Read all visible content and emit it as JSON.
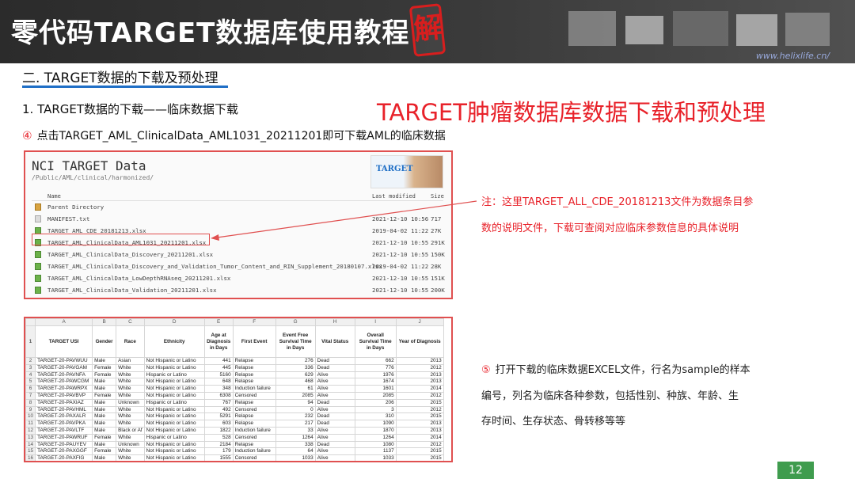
{
  "banner": {
    "title": "零代码TARGET数据库使用教程",
    "seal_char": "解",
    "site_url": "www.helixlife.cn/"
  },
  "section_title": "二. TARGET数据的下载及预处理",
  "sub_title": "1. TARGET数据的下载——临床数据下载",
  "big_title": "TARGET肿瘤数据库数据下载和预处理",
  "step4": {
    "circle": "④",
    "text": "点击TARGET_AML_ClinicalData_AML1031_20211201即可下载AML的临床数据"
  },
  "nci": {
    "title": "NCI TARGET Data",
    "path": "/Public/AML/clinical/harmonized/",
    "logo_text": "TARGET",
    "col_name": "Name",
    "col_modified": "Last modified",
    "col_size": "Size",
    "rows": [
      {
        "icon": "folder",
        "name": "Parent Directory",
        "modified": "",
        "size": ""
      },
      {
        "icon": "txt",
        "name": "MANIFEST.txt",
        "modified": "2021-12-10 10:56",
        "size": "717"
      },
      {
        "icon": "xlsx",
        "name": "TARGET_AML_CDE_20181213.xlsx",
        "modified": "2019-04-02 11:22",
        "size": "27K"
      },
      {
        "icon": "xlsx",
        "name": "TARGET_AML_ClinicalData_AML1031_20211201.xlsx",
        "modified": "2021-12-10 10:55",
        "size": "291K"
      },
      {
        "icon": "xlsx",
        "name": "TARGET_AML_ClinicalData_Discovery_20211201.xlsx",
        "modified": "2021-12-10 10:55",
        "size": "150K"
      },
      {
        "icon": "xlsx",
        "name": "TARGET_AML_ClinicalData_Discovery_and_Validation_Tumor_Content_and_RIN_Supplement_20180107.xlsx",
        "modified": "2019-04-02 11:22",
        "size": "28K"
      },
      {
        "icon": "xlsx",
        "name": "TARGET_AML_ClinicalData_LowDepthRNAseq_20211201.xlsx",
        "modified": "2021-12-10 10:55",
        "size": "151K"
      },
      {
        "icon": "xlsx",
        "name": "TARGET_AML_ClinicalData_Validation_20211201.xlsx",
        "modified": "2021-12-10 10:55",
        "size": "200K"
      }
    ]
  },
  "note_cde": {
    "line1": "注：这里TARGET_ALL_CDE_20181213文件为数据条目参",
    "line2": "数的说明文件，下载可查阅对应临床参数信息的具体说明"
  },
  "excel": {
    "col_letters": [
      "",
      "A",
      "B",
      "C",
      "D",
      "E",
      "F",
      "G",
      "H",
      "I",
      "J"
    ],
    "header_row_num": "1",
    "headers": [
      "TARGET USI",
      "Gender",
      "Race",
      "Ethnicity",
      "Age at Diagnosis in Days",
      "First Event",
      "Event Free Survival Time in Days",
      "Vital Status",
      "Overall Survival Time in Days",
      "Year of Diagnosis"
    ],
    "rows": [
      [
        "2",
        "TARGET-20-PAVWUU",
        "Male",
        "Asian",
        "Not Hispanic or Latino",
        "441",
        "Relapse",
        "276",
        "Dead",
        "662",
        "2013"
      ],
      [
        "3",
        "TARGET-20-PAVGAM",
        "Female",
        "White",
        "Not Hispanic or Latino",
        "445",
        "Relapse",
        "336",
        "Dead",
        "776",
        "2012"
      ],
      [
        "4",
        "TARGET-20-PAVNFA",
        "Female",
        "White",
        "Hispanic or Latino",
        "5160",
        "Relapse",
        "629",
        "Alive",
        "1976",
        "2013"
      ],
      [
        "5",
        "TARGET-20-PAWCGM",
        "Male",
        "White",
        "Not Hispanic or Latino",
        "648",
        "Relapse",
        "468",
        "Alive",
        "1674",
        "2013"
      ],
      [
        "6",
        "TARGET-20-PAWRPX",
        "Male",
        "White",
        "Not Hispanic or Latino",
        "348",
        "Induction failure",
        "61",
        "Alive",
        "1601",
        "2014"
      ],
      [
        "7",
        "TARGET-20-PAVBVP",
        "Female",
        "White",
        "Not Hispanic or Latino",
        "6308",
        "Censored",
        "2085",
        "Alive",
        "2085",
        "2012"
      ],
      [
        "8",
        "TARGET-20-PAXIAZ",
        "Male",
        "Unknown",
        "Hispanic or Latino",
        "767",
        "Relapse",
        "94",
        "Dead",
        "206",
        "2015"
      ],
      [
        "9",
        "TARGET-20-PAVHML",
        "Male",
        "White",
        "Not Hispanic or Latino",
        "492",
        "Censored",
        "0",
        "Alive",
        "3",
        "2012"
      ],
      [
        "10",
        "TARGET-20-PAXALR",
        "Male",
        "White",
        "Not Hispanic or Latino",
        "5291",
        "Relapse",
        "232",
        "Dead",
        "310",
        "2015"
      ],
      [
        "11",
        "TARGET-20-PAVPKA",
        "Male",
        "White",
        "Not Hispanic or Latino",
        "603",
        "Relapse",
        "217",
        "Dead",
        "1090",
        "2013"
      ],
      [
        "12",
        "TARGET-20-PAVLTF",
        "Male",
        "Black or Af",
        "Not Hispanic or Latino",
        "1822",
        "Induction failure",
        "33",
        "Alive",
        "1870",
        "2013"
      ],
      [
        "13",
        "TARGET-20-PAWRUF",
        "Female",
        "White",
        "Hispanic or Latino",
        "528",
        "Censored",
        "1264",
        "Alive",
        "1264",
        "2014"
      ],
      [
        "14",
        "TARGET-20-PAUYEV",
        "Male",
        "Unknown",
        "Not Hispanic or Latino",
        "2184",
        "Relapse",
        "338",
        "Dead",
        "1080",
        "2012"
      ],
      [
        "15",
        "TARGET-20-PAXGGF",
        "Female",
        "White",
        "Not Hispanic or Latino",
        "179",
        "Induction failure",
        "64",
        "Alive",
        "1137",
        "2015"
      ],
      [
        "16",
        "TARGET-20-PAXFIG",
        "Male",
        "White",
        "Not Hispanic or Latino",
        "1555",
        "Censored",
        "1033",
        "Alive",
        "1033",
        "2015"
      ]
    ]
  },
  "note_excel": {
    "circle": "⑤",
    "line1": "打开下载的临床数据EXCEL文件，行名为sample的样本",
    "line2": "编号，列名为临床各种参数，包括性别、种族、年龄、生",
    "line3": "存时间、生存状态、骨转移等等"
  },
  "page_number": "12",
  "colors": {
    "accent_red": "#e8222a",
    "underline_blue": "#1f6fc6",
    "page_green": "#3f9c4e"
  }
}
